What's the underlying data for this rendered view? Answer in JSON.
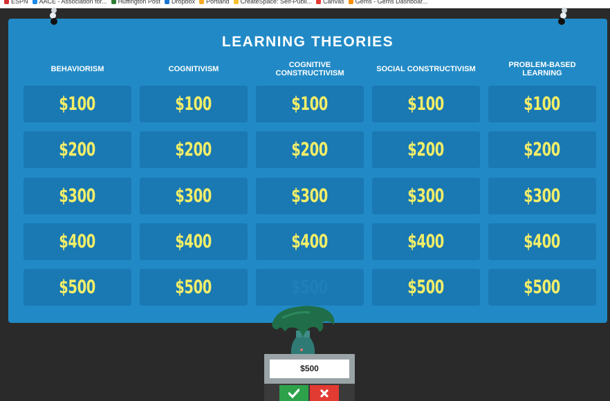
{
  "bookmarks": [
    {
      "label": "ESPN",
      "color": "#d32f2f"
    },
    {
      "label": "AACE - Association for...",
      "color": "#1e88e5"
    },
    {
      "label": "Huffington Post",
      "color": "#2e7d32"
    },
    {
      "label": "Dropbox",
      "color": "#1976d2"
    },
    {
      "label": "Portland",
      "color": "#f9a825"
    },
    {
      "label": "CreateSpace: Self-Publi...",
      "color": "#fbc02d"
    },
    {
      "label": "Canvas",
      "color": "#e53935"
    },
    {
      "label": "Gems - Gems Dashboar...",
      "color": "#fb8c00"
    }
  ],
  "board": {
    "title": "LEARNING THEORIES",
    "categories": [
      "BEHAVIORISM",
      "COGNITIVISM",
      "COGNITIVE\nCONSTRUCTIVISM",
      "SOCIAL CONSTRUCTIVISM",
      "PROBLEM-BASED\nLEARNING"
    ],
    "values": [
      "$100",
      "$200",
      "$300",
      "$400",
      "$500"
    ],
    "used_tiles": [
      {
        "column": 3,
        "row": 5
      }
    ],
    "colors": {
      "board": "#218ac6",
      "tile": "#1a78b3",
      "tile_text": "#f2ee68"
    }
  },
  "wager": {
    "value": "$500",
    "confirm_icon": "check-icon",
    "cancel_icon": "x-icon"
  },
  "avatar_icon": "tree-player-avatar"
}
